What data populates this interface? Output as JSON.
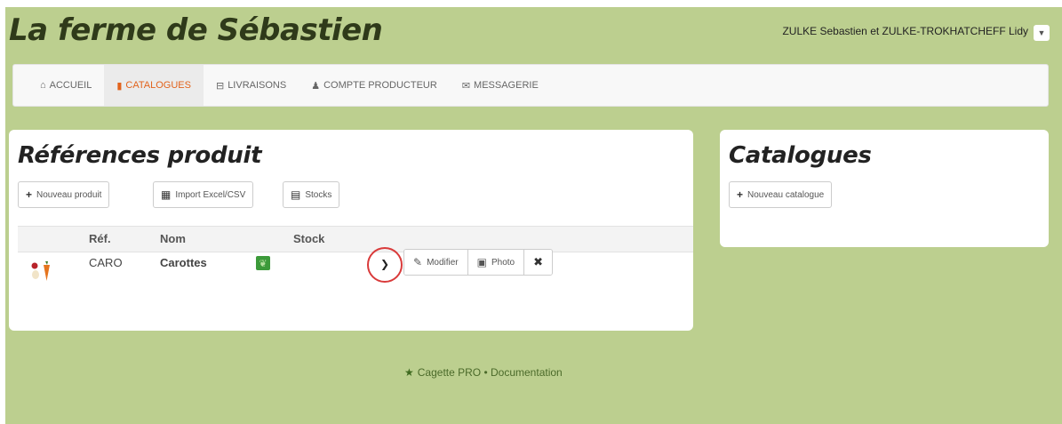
{
  "app": {
    "title": "La ferme de Sébastien"
  },
  "user": {
    "name": "ZULKE Sebastien et ZULKE-TROKHATCHEFF Lidy"
  },
  "nav": {
    "items": [
      {
        "label": "ACCUEIL",
        "icon": "home-icon",
        "glyph": "🏠"
      },
      {
        "label": "CATALOGUES",
        "icon": "book-icon",
        "glyph": "📕",
        "active": true
      },
      {
        "label": "LIVRAISONS",
        "icon": "basket-icon",
        "glyph": "🧺"
      },
      {
        "label": "COMPTE PRODUCTEUR",
        "icon": "user-icon",
        "glyph": "👤"
      },
      {
        "label": "MESSAGERIE",
        "icon": "envelope-icon",
        "glyph": "✉"
      }
    ]
  },
  "products": {
    "title": "Références produit",
    "buttons": {
      "new_product": "Nouveau produit",
      "import": "Import Excel/CSV",
      "stocks": "Stocks"
    },
    "columns": {
      "ref": "Réf.",
      "name": "Nom",
      "stock": "Stock"
    },
    "rows": [
      {
        "ref": "CARO",
        "name": "Carottes",
        "stock": "",
        "icon": "carrot-icon",
        "badge": "bio-icon"
      }
    ],
    "actions": {
      "modify": "Modifier",
      "photo": "Photo"
    }
  },
  "catalogs": {
    "title": "Catalogues",
    "new_catalog": "Nouveau catalogue"
  },
  "footer": {
    "text": "Cagette PRO • Documentation",
    "icon": "star-icon"
  },
  "colors": {
    "background": "#bccf8f",
    "accent": "#e2631c",
    "highlight": "#d93a3a"
  }
}
